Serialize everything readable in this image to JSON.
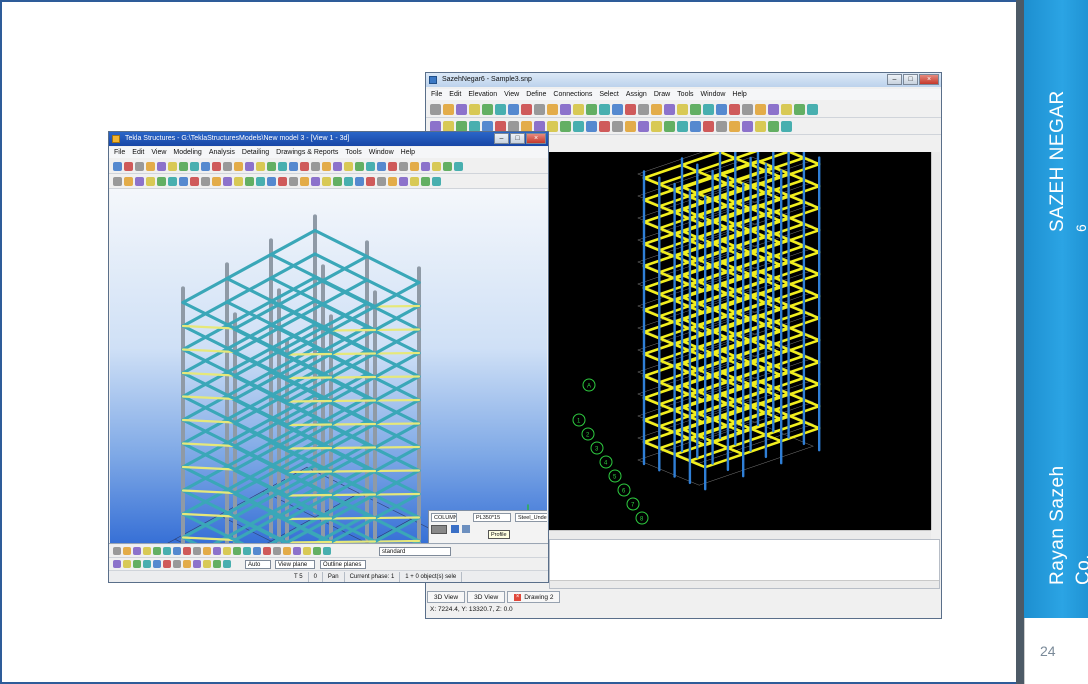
{
  "slide": {
    "side_title_line1": "SAZEH NEGAR",
    "side_title_line2": "6",
    "side_footer_line1": "Rayan  Sazeh",
    "side_footer_line2": "Co.",
    "page_number": "24",
    "colors": {
      "side_panel": "#2ba4e4",
      "border": "#2e5c99"
    }
  },
  "tekla": {
    "title": "Tekla Structures - G:\\TeklaStructuresModels\\New model 3 - [View 1 - 3d]",
    "menu": [
      "File",
      "Edit",
      "View",
      "Modeling",
      "Analysis",
      "Detailing",
      "Drawings & Reports",
      "Tools",
      "Window",
      "Help"
    ],
    "popup": {
      "profile": "COLUMN",
      "material": "PL350*15",
      "class": "Steel_Unde"
    },
    "tooltip": "Profile",
    "combo_standard": "standard",
    "combo_auto": "Auto",
    "combo_view_plane": "View plane",
    "combo_outline": "Outline planes",
    "status": {
      "s1": "T 5",
      "s2": "0",
      "s3": "Pan",
      "s4": "Current phase: 1",
      "s5": "1 + 0 object(s) sele"
    }
  },
  "sazeh": {
    "title": "SazehNegar6 - Sample3.snp",
    "menu": [
      "File",
      "Edit",
      "Elevation",
      "View",
      "Define",
      "Connections",
      "Select",
      "Assign",
      "Draw",
      "Tools",
      "Window",
      "Help"
    ],
    "tabs": {
      "tab1": "3D View",
      "tab2": "3D View",
      "tab3": "Drawing 2"
    },
    "coords": "X: 7224.4, Y: 13320.7, Z: 0.0"
  }
}
